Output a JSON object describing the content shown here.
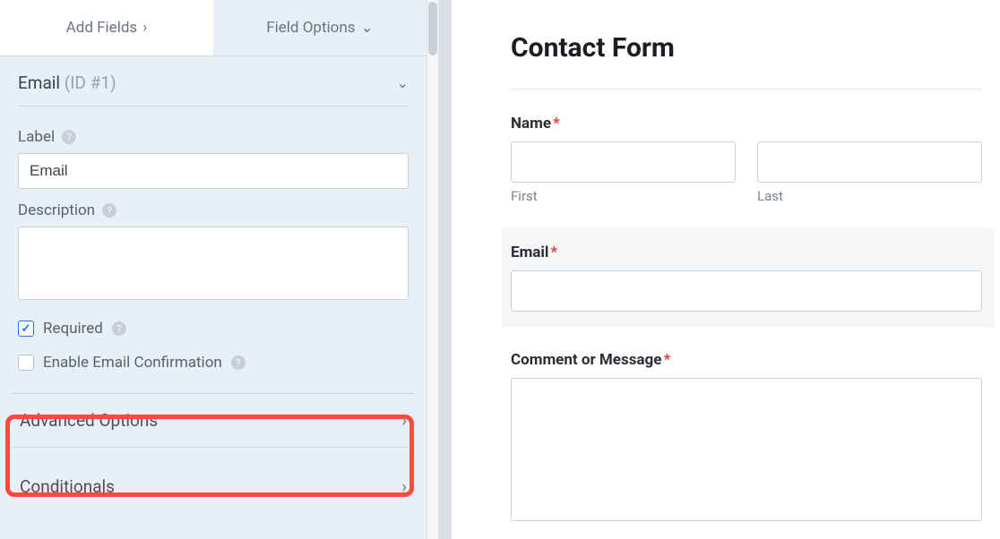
{
  "tabs": {
    "add_fields": "Add Fields",
    "field_options": "Field Options"
  },
  "section": {
    "title": "Email",
    "id_prefix": "(ID #",
    "id_value": "1",
    "id_suffix": ")"
  },
  "options": {
    "label_label": "Label",
    "label_value": "Email",
    "description_label": "Description",
    "description_value": "",
    "required_label": "Required",
    "confirm_label": "Enable Email Confirmation"
  },
  "accordions": {
    "advanced": "Advanced Options",
    "conditionals": "Conditionals"
  },
  "form": {
    "title": "Contact Form",
    "name_label": "Name",
    "first_sub": "First",
    "last_sub": "Last",
    "email_label": "Email",
    "comment_label": "Comment or Message"
  }
}
